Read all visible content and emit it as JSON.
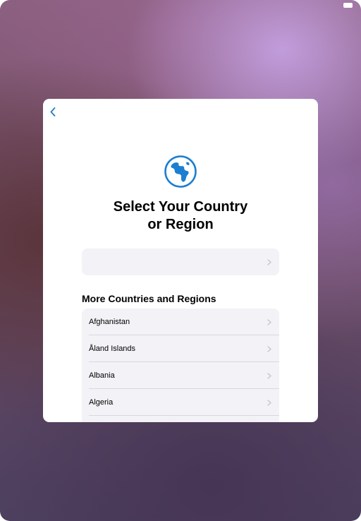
{
  "status_bar": {
    "battery_icon": "battery-icon"
  },
  "setup": {
    "back_icon": "chevron-left-icon",
    "globe_icon": "globe-icon",
    "title_line1": "Select Your Country",
    "title_line2": "or Region",
    "suggested_label": "",
    "section_header": "More Countries and Regions",
    "countries": [
      {
        "name": "Afghanistan"
      },
      {
        "name": "Åland Islands"
      },
      {
        "name": "Albania"
      },
      {
        "name": "Algeria"
      },
      {
        "name": ""
      }
    ]
  },
  "colors": {
    "accent": "#1b7fd1",
    "card_background": "#ffffff",
    "row_background": "#f2f2f7",
    "chevron": "#c4c4c9",
    "divider": "#d8d8dc"
  }
}
